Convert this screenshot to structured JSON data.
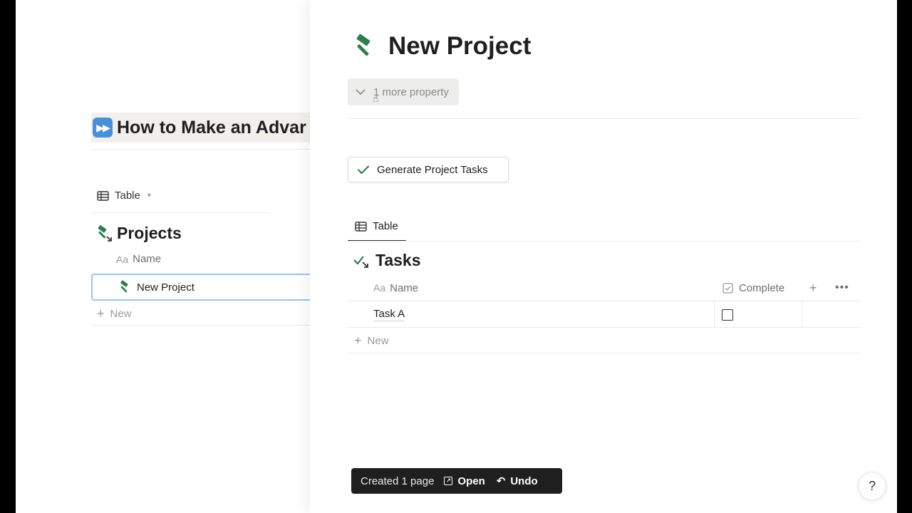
{
  "colors": {
    "accent_green": "#2e7d4f",
    "toast_bg": "#1f1f1f",
    "row_selected_border": "#9cc3e6",
    "banner_bg": "#f1f0ec"
  },
  "left_page": {
    "banner_title": "How to Make an Advar",
    "banner_icon": "next-track-icon",
    "view_tab": {
      "label": "Table",
      "icon": "table-icon"
    },
    "database": {
      "title": "Projects",
      "icon": "hammer-arrow-icon",
      "column_name": "Name",
      "rows": [
        {
          "name": "New Project",
          "icon": "hammer-icon"
        }
      ],
      "new_label": "New"
    }
  },
  "peek": {
    "title": "New Project",
    "title_icon": "hammer-icon",
    "more_property_label": "1 more property",
    "generate_button_label": "Generate Project Tasks",
    "view_tab": {
      "label": "Table",
      "icon": "table-icon"
    },
    "tasks_db": {
      "title": "Tasks",
      "icon": "checklist-arrow-icon",
      "columns": {
        "name": "Name",
        "complete": "Complete"
      },
      "rows": [
        {
          "name": "Task A",
          "complete": false
        }
      ],
      "new_label": "New"
    }
  },
  "toast": {
    "message": "Created 1 page",
    "open_label": "Open",
    "undo_label": "Undo"
  },
  "help": {
    "label": "?"
  }
}
